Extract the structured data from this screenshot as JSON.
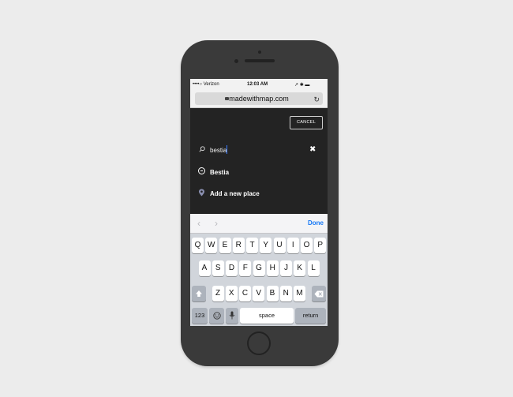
{
  "status_bar": {
    "carrier": "••••○ Verizon",
    "time": "12:03 AM",
    "icons": "↗ ✱ ▬"
  },
  "browser": {
    "url": "madewithmap.com",
    "reload_icon": "reload-icon"
  },
  "search": {
    "cancel_label": "CANCEL",
    "query": "bestia"
  },
  "results": [
    {
      "label": "Bestia",
      "icon": "minus-circle-icon"
    },
    {
      "label": "Add a new place",
      "icon": "map-pin-icon"
    }
  ],
  "keyboard": {
    "done_label": "Done",
    "row1": [
      "Q",
      "W",
      "E",
      "R",
      "T",
      "Y",
      "U",
      "I",
      "O",
      "P"
    ],
    "row2": [
      "A",
      "S",
      "D",
      "F",
      "G",
      "H",
      "J",
      "K",
      "L"
    ],
    "row3": [
      "Z",
      "X",
      "C",
      "V",
      "B",
      "N",
      "M"
    ],
    "numbers_label": "123",
    "space_label": "space",
    "return_label": "return"
  }
}
